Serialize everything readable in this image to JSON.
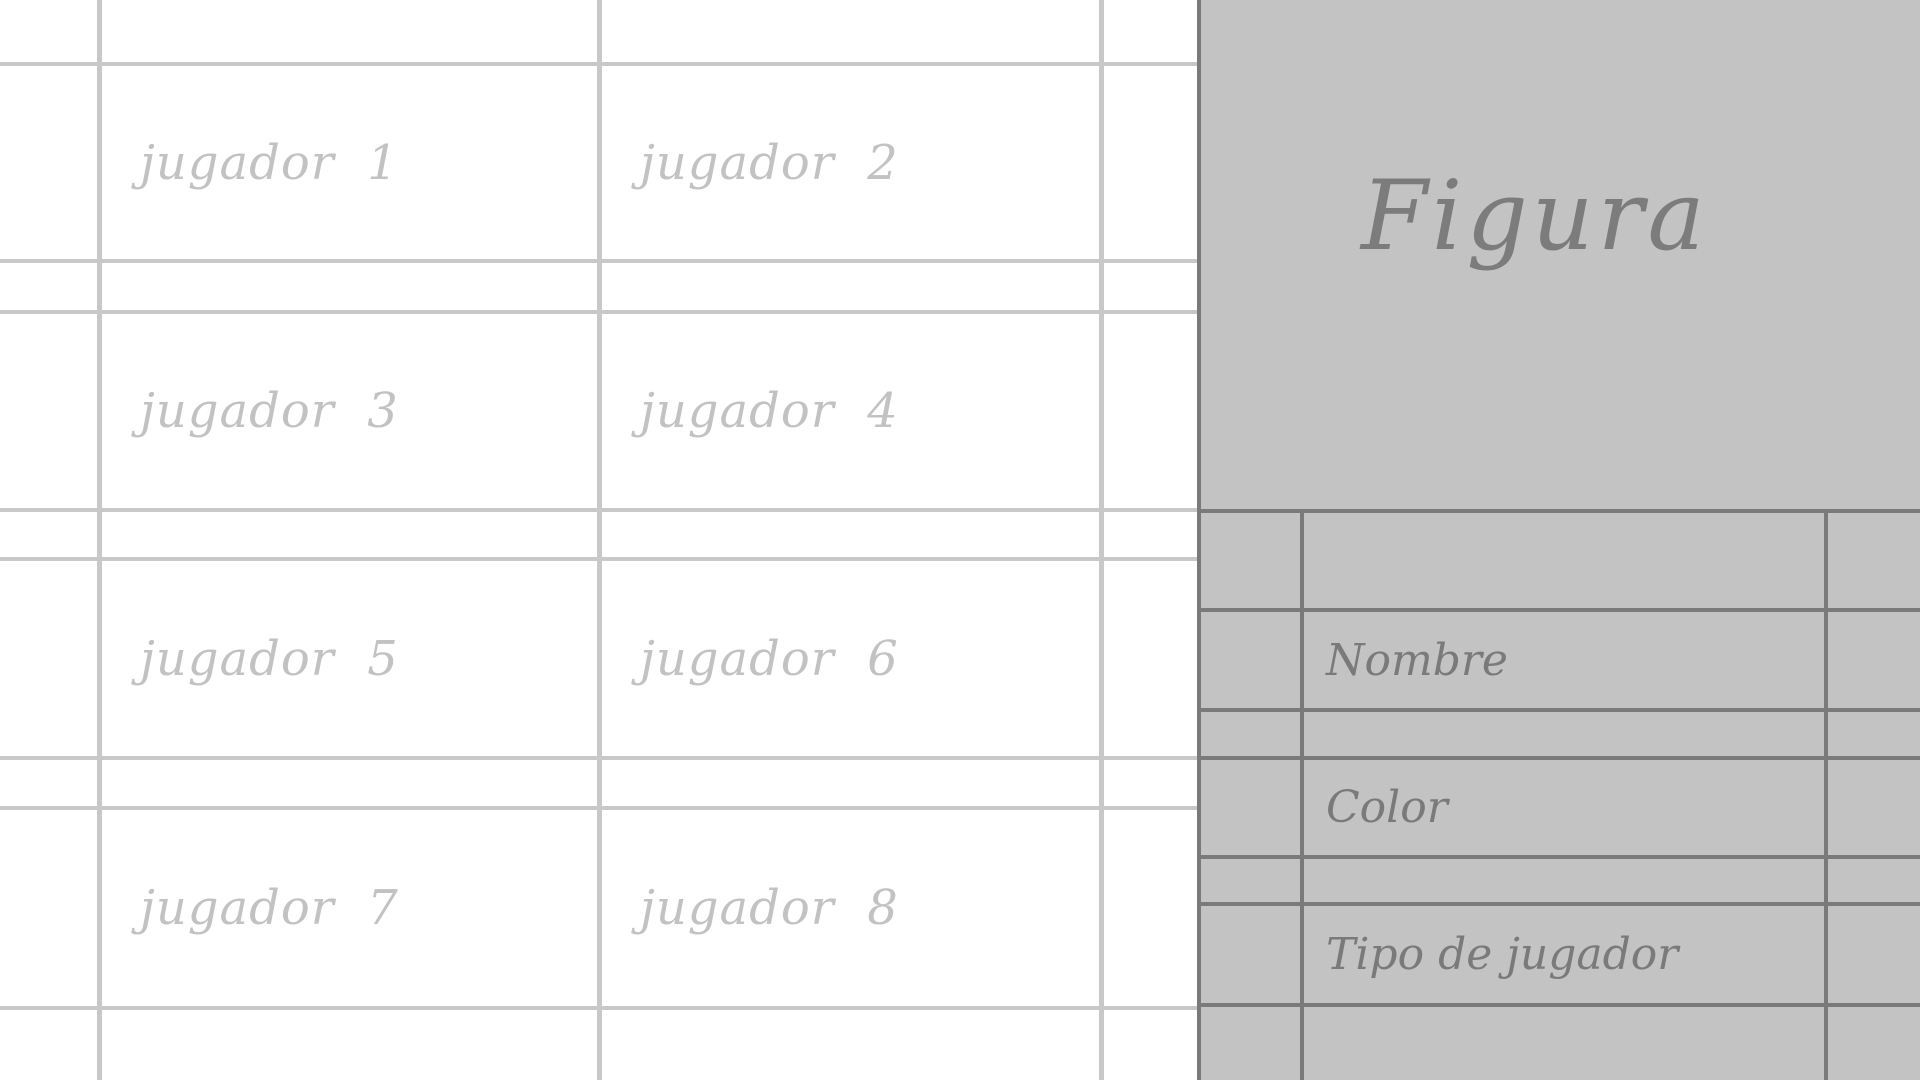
{
  "players": [
    {
      "label": "jugador  1"
    },
    {
      "label": "jugador  2"
    },
    {
      "label": "jugador  3"
    },
    {
      "label": "jugador  4"
    },
    {
      "label": "jugador  5"
    },
    {
      "label": "jugador  6"
    },
    {
      "label": "jugador  7"
    },
    {
      "label": "jugador  8"
    }
  ],
  "panel": {
    "title": "Figura",
    "fields": {
      "name_label": "Nombre",
      "color_label": "Color",
      "type_label": "Tipo de jugador"
    }
  },
  "colors": {
    "board_background": "#ffffff",
    "board_lines": "#c8c8c8",
    "board_text": "#c2c2c2",
    "panel_background": "#c3c3c3",
    "panel_lines": "#7a7a7a",
    "panel_text": "#7a7a7a"
  }
}
